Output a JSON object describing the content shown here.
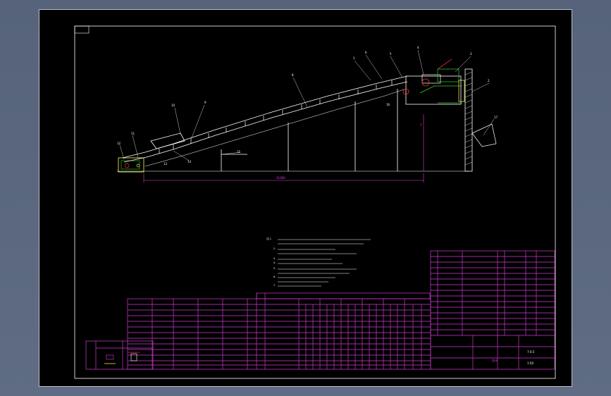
{
  "balloons": [
    "1",
    "2",
    "3",
    "4",
    "5",
    "6",
    "7",
    "8",
    "9",
    "10",
    "11",
    "12",
    "13",
    "14",
    "15",
    "16",
    "17"
  ],
  "dimension": "21000",
  "sheet_corner_label": "设计",
  "notes": [
    "注:1.",
    "2.",
    "3.",
    "4.",
    "5.",
    "6.",
    "7."
  ],
  "title_block": {
    "drawing_no": "7-0.5",
    "scale": "1:50"
  },
  "colors": {
    "frame": "#ffffff",
    "lines": "#ffffff",
    "table_lines": "#d23ad2",
    "magenta": "#e23ce2",
    "yellow": "#e8e84a",
    "green": "#37d037",
    "red": "#e23030",
    "background": "#000000"
  }
}
